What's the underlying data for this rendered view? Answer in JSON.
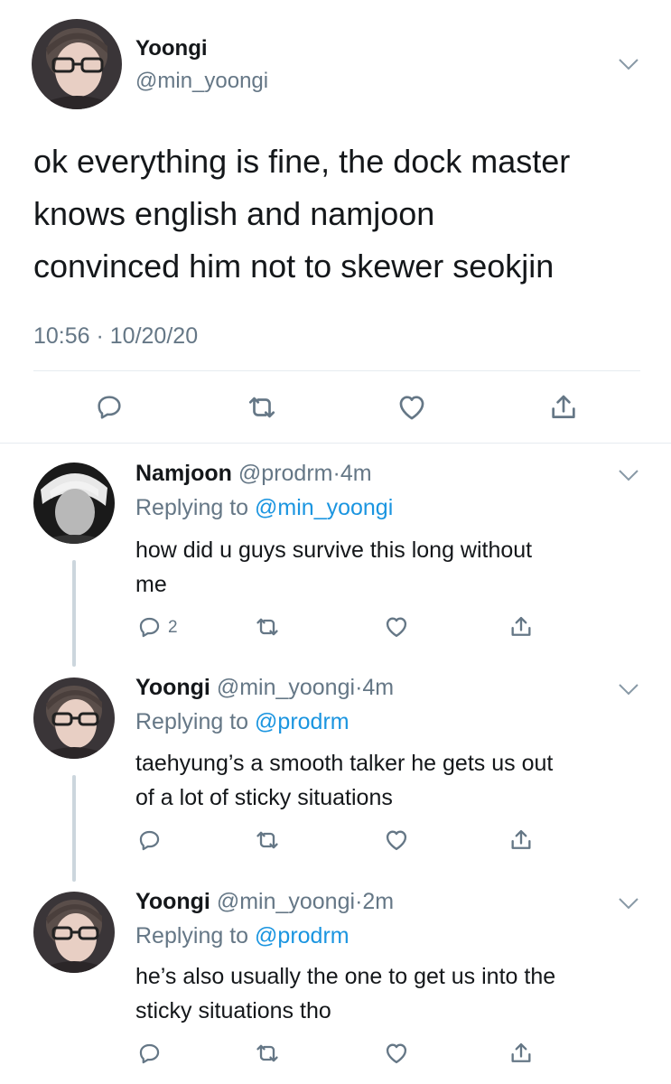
{
  "main_tweet": {
    "display_name": "Yoongi",
    "handle": "@min_yoongi",
    "text_lines": [
      "ok everything is fine, the dock master",
      "knows english and namjoon",
      "convinced him not to skewer seokjin"
    ],
    "timestamp": "10:56 · 10/20/20",
    "icons": [
      "reply-icon",
      "retweet-icon",
      "like-icon",
      "share-icon"
    ]
  },
  "replies": [
    {
      "display_name": "Namjoon",
      "handle": "@prodrm",
      "dot": "·",
      "time": "4m",
      "replying_prefix": "Replying to",
      "replying_to": "@min_yoongi",
      "text_lines": [
        "how did u guys survive this long without",
        "me"
      ],
      "reply_count": "2"
    },
    {
      "display_name": "Yoongi",
      "handle": "@min_yoongi",
      "dot": "·",
      "time": "4m",
      "replying_prefix": "Replying to",
      "replying_to": "@prodrm",
      "text_lines": [
        "taehyung’s a smooth talker he gets us out",
        "of a lot of sticky situations"
      ],
      "reply_count": ""
    },
    {
      "display_name": "Yoongi",
      "handle": "@min_yoongi",
      "dot": "·",
      "time": "2m",
      "replying_prefix": "Replying to",
      "replying_to": "@prodrm",
      "text_lines": [
        "he’s also usually the one to get us into the",
        "sticky situations tho"
      ],
      "reply_count": ""
    }
  ],
  "colors": {
    "text": "#14171a",
    "secondary": "#657786",
    "link": "#1b95e0",
    "icon": "#657786",
    "divider": "#e6ecf0",
    "thread_line": "#ccd6dd"
  }
}
